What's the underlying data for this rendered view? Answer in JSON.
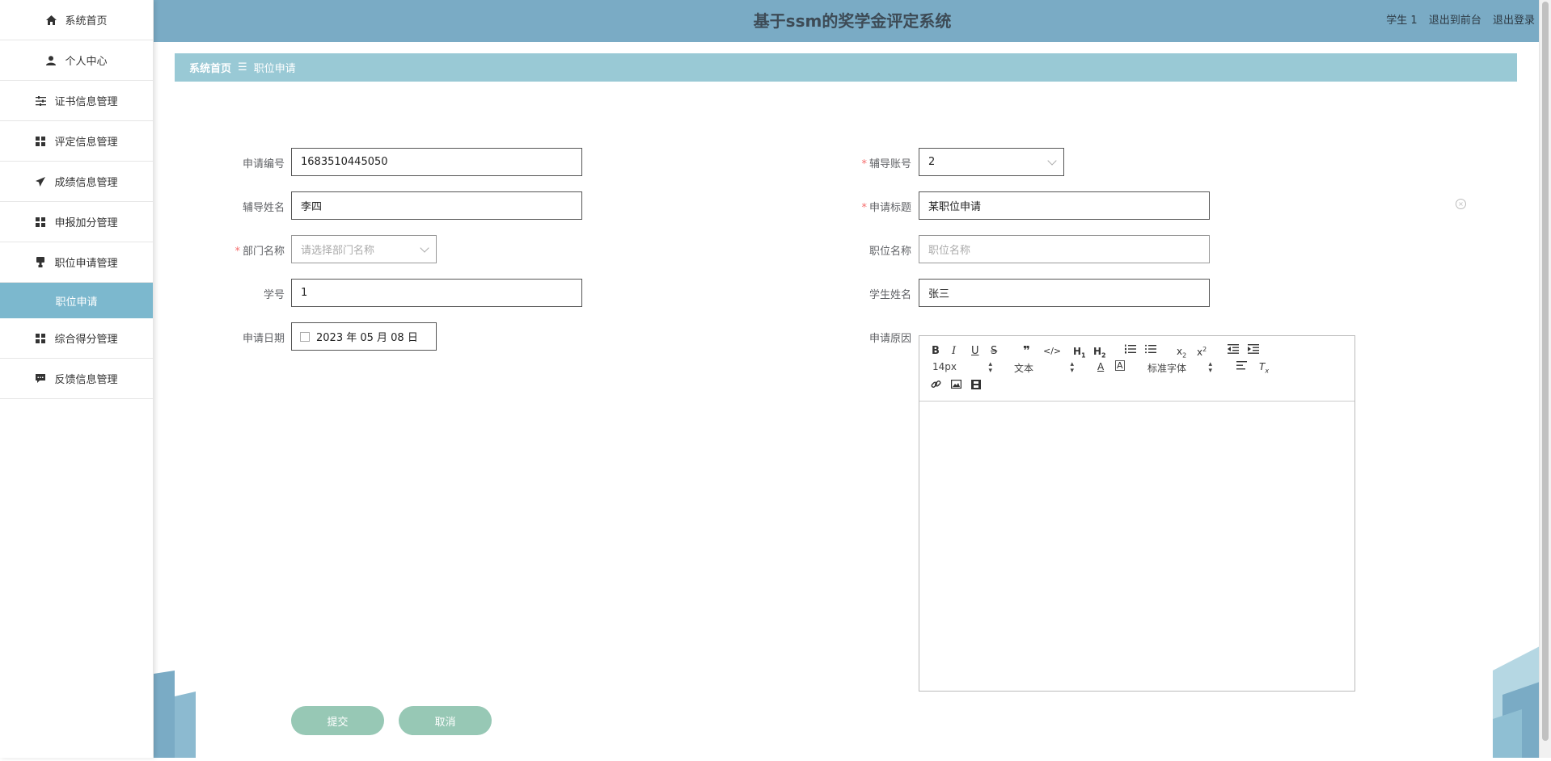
{
  "header": {
    "title": "基于ssm的奖学金评定系统",
    "user": "学生 1",
    "back_frontend": "退出到前台",
    "logout": "退出登录"
  },
  "sidebar": {
    "items": [
      {
        "label": "系统首页",
        "icon": "home-icon"
      },
      {
        "label": "个人中心",
        "icon": "user-icon"
      },
      {
        "label": "证书信息管理",
        "icon": "sliders-icon"
      },
      {
        "label": "评定信息管理",
        "icon": "grid-icon"
      },
      {
        "label": "成绩信息管理",
        "icon": "send-icon"
      },
      {
        "label": "申报加分管理",
        "icon": "grid-icon"
      },
      {
        "label": "职位申请管理",
        "icon": "stamp-icon"
      },
      {
        "label": "综合得分管理",
        "icon": "grid-icon"
      },
      {
        "label": "反馈信息管理",
        "icon": "chat-icon"
      }
    ],
    "active_sub": "职位申请"
  },
  "breadcrumb": {
    "home": "系统首页",
    "sep": "☰",
    "current": "职位申请"
  },
  "form": {
    "apply_no": {
      "label": "申请编号",
      "value": "1683510445050"
    },
    "tutor_account": {
      "label": "辅导账号",
      "value": "2",
      "required": true
    },
    "tutor_name": {
      "label": "辅导姓名",
      "value": "李四"
    },
    "apply_title": {
      "label": "申请标题",
      "value": "某职位申请",
      "required": true
    },
    "department": {
      "label": "部门名称",
      "placeholder": "请选择部门名称",
      "required": true
    },
    "position": {
      "label": "职位名称",
      "placeholder": "职位名称"
    },
    "student_no": {
      "label": "学号",
      "value": "1"
    },
    "student_name": {
      "label": "学生姓名",
      "value": "张三"
    },
    "apply_date": {
      "label": "申请日期",
      "value": "2023 年 05 月 08 日"
    },
    "reason": {
      "label": "申请原因"
    }
  },
  "editor": {
    "font_size": "14px",
    "header_select": "文本",
    "font_family": "标准字体"
  },
  "buttons": {
    "submit": "提交",
    "cancel": "取消"
  }
}
